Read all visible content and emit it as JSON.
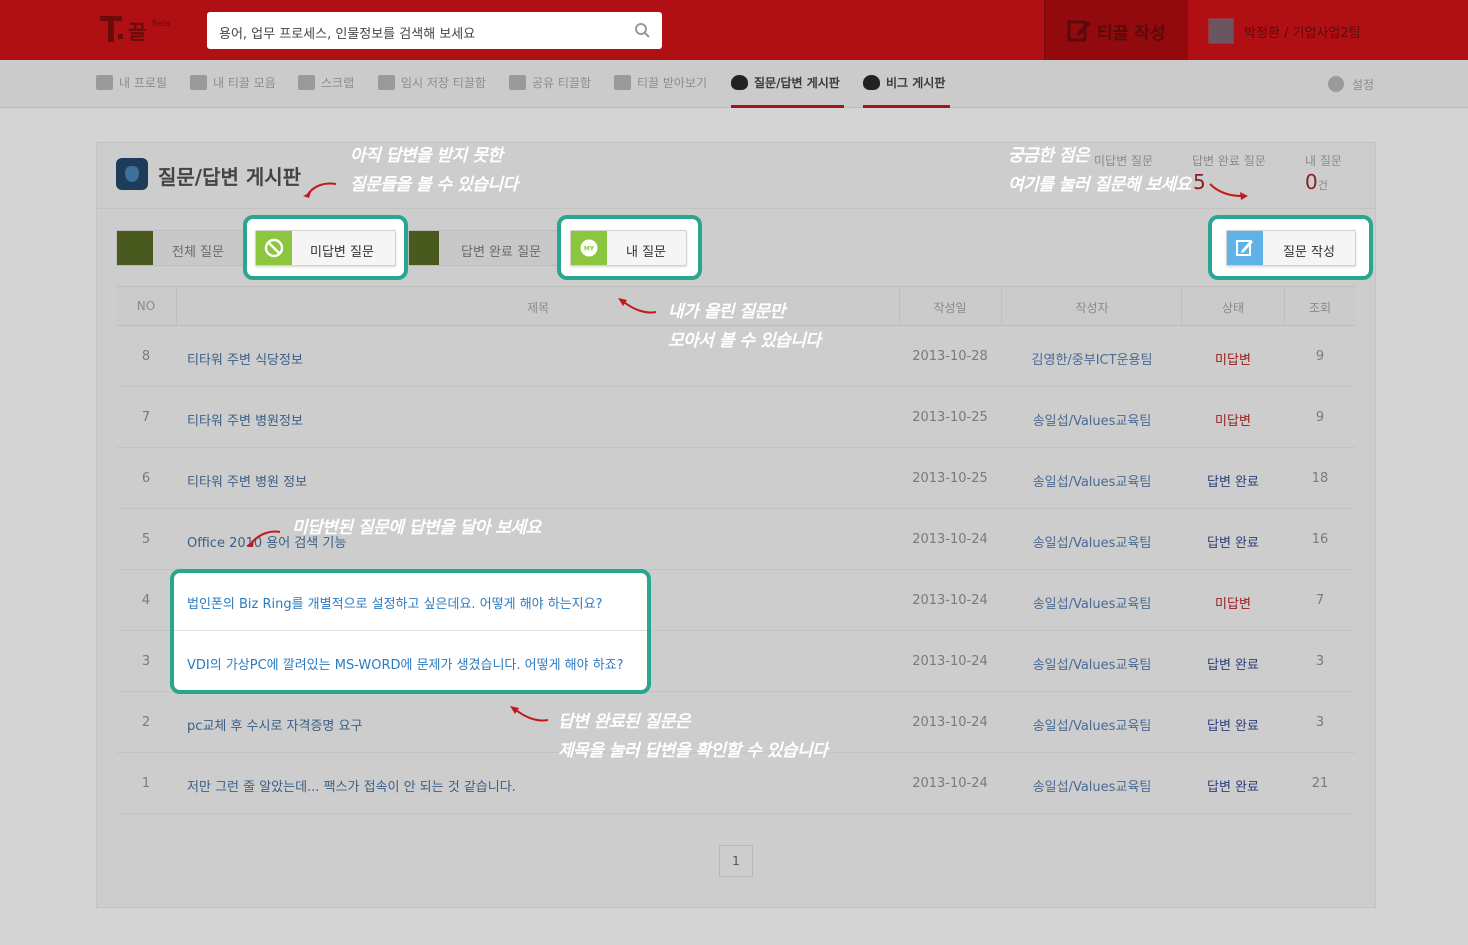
{
  "header": {
    "search_placeholder": "용어, 업무 프로세스, 인물정보를 검색해 보세요",
    "write_label": "티끌 작성",
    "user": "박정환 / 기업사업2팀"
  },
  "nav": {
    "items": [
      {
        "label": "내 프로필"
      },
      {
        "label": "내 티끌 모음"
      },
      {
        "label": "스크랩"
      },
      {
        "label": "임시 저장 티끌함"
      },
      {
        "label": "공유 티끌함"
      },
      {
        "label": "티끌 받아보기"
      },
      {
        "label": "질문/답변 게시판"
      },
      {
        "label": "비그 게시판"
      }
    ],
    "settings": "설정"
  },
  "board": {
    "title": "질문/답변 게시판",
    "stats": [
      {
        "label": "미답변 질문",
        "value": "",
        "unit": ""
      },
      {
        "label": "답변 완료 질문",
        "value": "5",
        "unit": ""
      },
      {
        "label": "내 질문",
        "value": "0",
        "unit": "건"
      }
    ]
  },
  "filters": {
    "all": "전체 질문",
    "unanswered": "미답변 질문",
    "answered": "답변 완료 질문",
    "mine": "내 질문",
    "mine_icon_text": "MY",
    "write": "질문 작성"
  },
  "table": {
    "headers": {
      "no": "NO",
      "title": "제목",
      "date": "작성일",
      "author": "작성자",
      "status": "상태",
      "views": "조회"
    },
    "rows": [
      {
        "no": "8",
        "title": "티타워 주변 식당정보",
        "date": "2013-10-28",
        "author": "김영한/중부ICT운용팀",
        "status": "미답변",
        "views": "9"
      },
      {
        "no": "7",
        "title": "티타워 주변 병원정보",
        "date": "2013-10-25",
        "author": "송일섭/Values교육팀",
        "status": "미답변",
        "views": "9"
      },
      {
        "no": "6",
        "title": "티타워 주변 병원 정보",
        "date": "2013-10-25",
        "author": "송일섭/Values교육팀",
        "status": "답변 완료",
        "views": "18"
      },
      {
        "no": "5",
        "title": "Office 2010 용어 검색 기능",
        "date": "2013-10-24",
        "author": "송일섭/Values교육팀",
        "status": "답변 완료",
        "views": "16"
      },
      {
        "no": "4",
        "title": "법인폰의 Biz Ring를 개별적으로 설정하고 싶은데요. 어떻게 해야 하는지요?",
        "date": "2013-10-24",
        "author": "송일섭/Values교육팀",
        "status": "미답변",
        "views": "7"
      },
      {
        "no": "3",
        "title": "VDI의 가상PC에 깔려있는 MS-WORD에 문제가 생겼습니다. 어떻게 해야 하죠?",
        "date": "2013-10-24",
        "author": "송일섭/Values교육팀",
        "status": "답변 완료",
        "views": "3"
      },
      {
        "no": "2",
        "title": "pc교체 후 수시로 자격증명 요구",
        "date": "2013-10-24",
        "author": "송일섭/Values교육팀",
        "status": "답변 완료",
        "views": "3"
      },
      {
        "no": "1",
        "title": "저만 그런 줄 알았는데... 팩스가 접속이 안 되는 것 같습니다.",
        "date": "2013-10-24",
        "author": "송일섭/Values교육팀",
        "status": "답변 완료",
        "views": "21"
      }
    ]
  },
  "pager": {
    "current": "1"
  },
  "annotations": {
    "unanswered": [
      "아직 답변을 받지 못한",
      "질문들을 볼 수 있습니다"
    ],
    "write": [
      "궁금한 점은",
      "여기를 눌러 질문해 보세요"
    ],
    "mine": [
      "내가 올린 질문만",
      "모아서 볼 수 있습니다"
    ],
    "answer": [
      "미답변된 질문에 답변을 달아 보세요"
    ],
    "completed": [
      "답변 완료된 질문은",
      "제목을 눌러 답변을 확인할 수 있습니다"
    ]
  },
  "colors": {
    "header": "#b00f13",
    "highlight": "#2aa58f",
    "unanswered": "#9b1a1a",
    "answered": "#2b3f7a",
    "link": "#2b7bc0"
  }
}
